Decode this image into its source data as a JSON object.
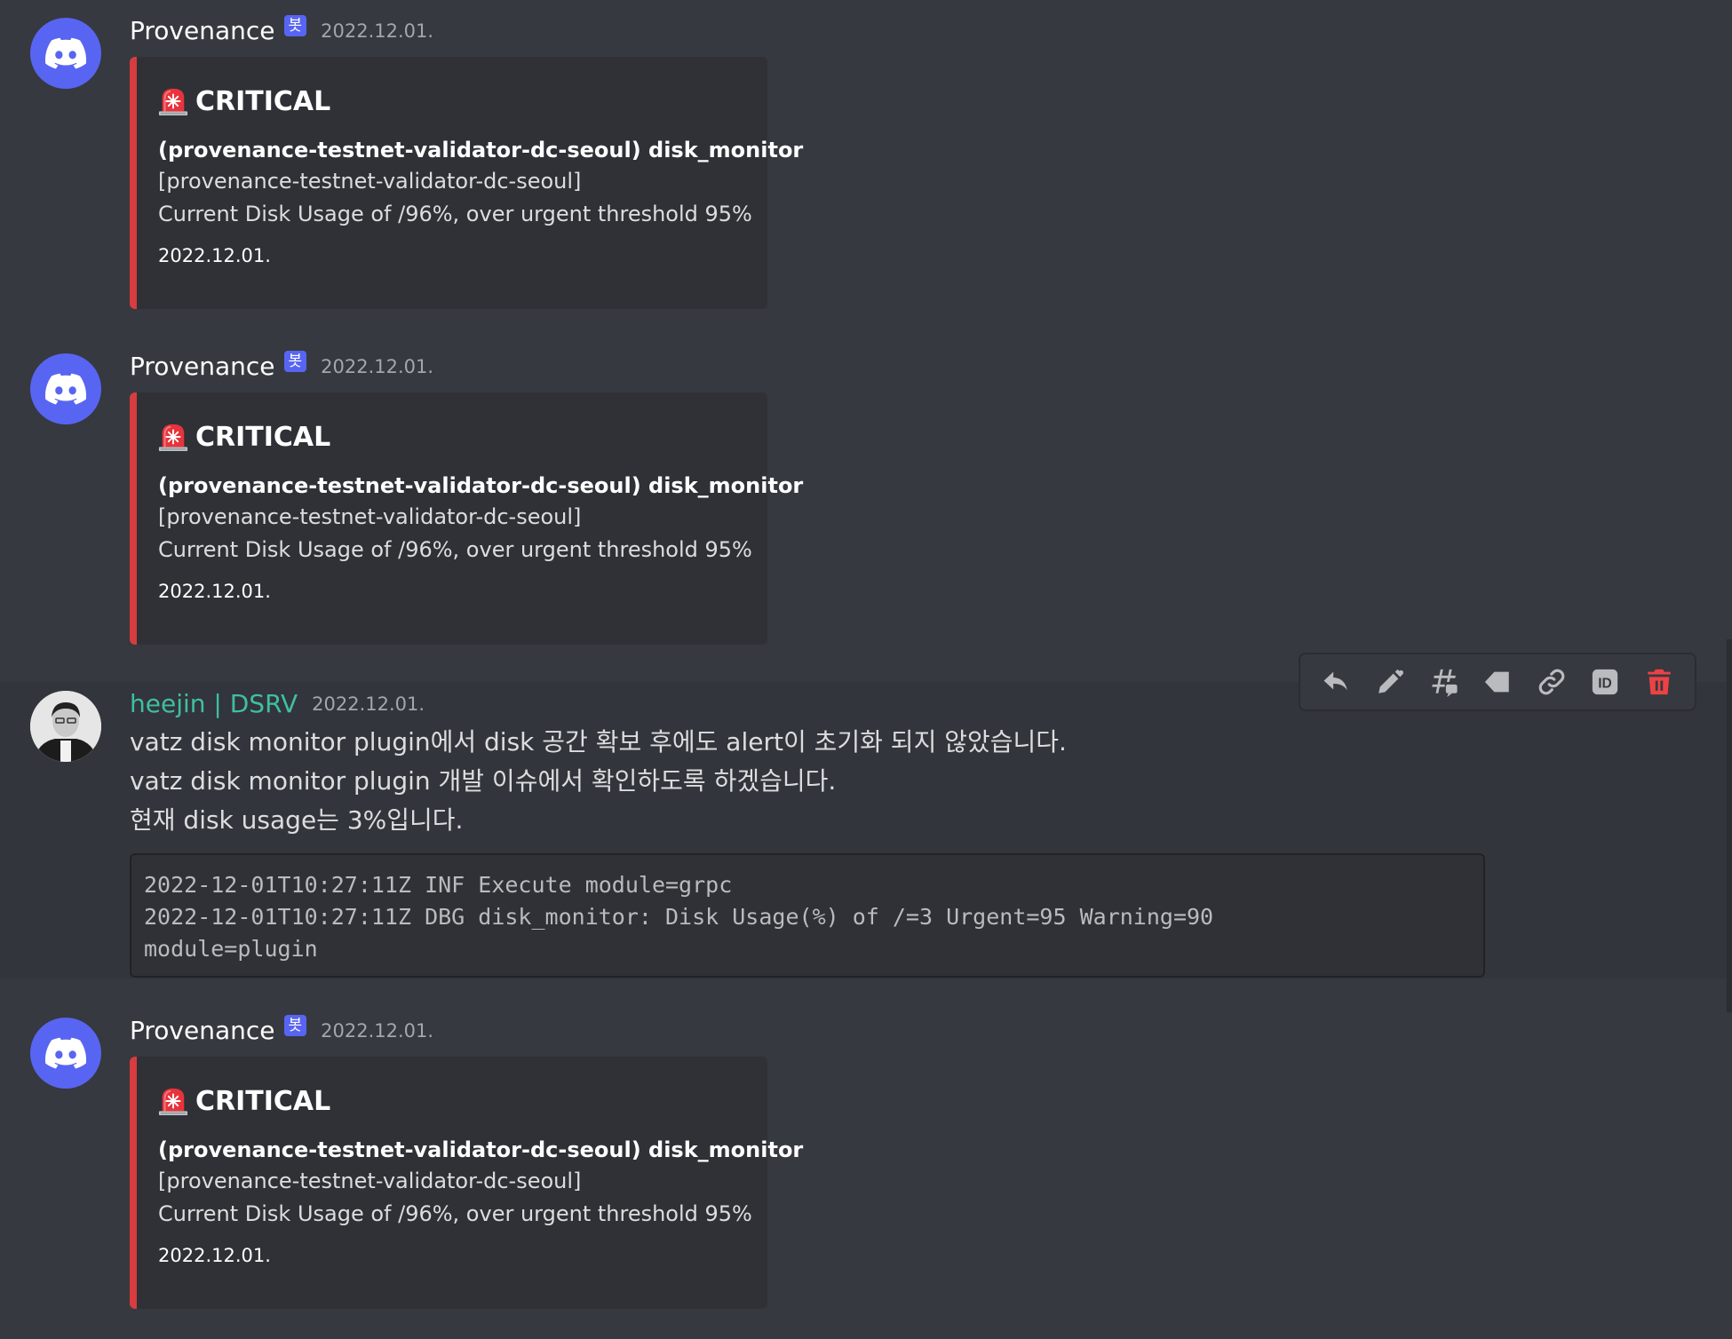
{
  "colors": {
    "background": "#36393f",
    "embed_background": "#2f3136",
    "embed_accent_critical": "#d83c3e",
    "blurple": "#5865f2",
    "username_user": "#3fbfa0",
    "delete_red": "#ed4245"
  },
  "messages": [
    {
      "author": "Provenance",
      "bot_tag": "봇",
      "avatar_icon": "discord-logo-icon",
      "timestamp": "2022.12.01.",
      "embed": {
        "icon": "rotating-light-icon",
        "title": "CRITICAL",
        "description_bold": "(provenance-testnet-validator-dc-seoul) disk_monitor",
        "description_lines": [
          "[provenance-testnet-validator-dc-seoul]",
          "Current Disk Usage of /96%, over urgent threshold 95%"
        ],
        "footer": "2022.12.01."
      }
    },
    {
      "author": "Provenance",
      "bot_tag": "봇",
      "avatar_icon": "discord-logo-icon",
      "timestamp": "2022.12.01.",
      "embed": {
        "icon": "rotating-light-icon",
        "title": "CRITICAL",
        "description_bold": "(provenance-testnet-validator-dc-seoul) disk_monitor",
        "description_lines": [
          "[provenance-testnet-validator-dc-seoul]",
          "Current Disk Usage of /96%, over urgent threshold 95%"
        ],
        "footer": "2022.12.01."
      }
    },
    {
      "author": "heejin | DSRV",
      "timestamp": "2022.12.01.",
      "text_lines": [
        "vatz disk monitor plugin에서 disk 공간 확보 후에도 alert이 초기화 되지 않았습니다.",
        "vatz disk monitor plugin 개발 이슈에서 확인하도록 하겠습니다.",
        "현재 disk usage는 3%입니다."
      ],
      "code_lines": [
        "2022-12-01T10:27:11Z INF Execute module=grpc",
        "2022-12-01T10:27:11Z DBG disk_monitor: Disk Usage(%) of /=3 Urgent=95 Warning=90",
        "module=plugin"
      ]
    },
    {
      "author": "Provenance",
      "bot_tag": "봇",
      "avatar_icon": "discord-logo-icon",
      "timestamp": "2022.12.01.",
      "embed": {
        "icon": "rotating-light-icon",
        "title": "CRITICAL",
        "description_bold": "(provenance-testnet-validator-dc-seoul) disk_monitor",
        "description_lines": [
          "[provenance-testnet-validator-dc-seoul]",
          "Current Disk Usage of /96%, over urgent threshold 95%"
        ],
        "footer": "2022.12.01."
      }
    }
  ],
  "toolbar": {
    "buttons": [
      "reply-icon",
      "edit-icon",
      "create-thread-icon",
      "tag-icon",
      "copy-link-icon",
      "copy-id-icon",
      "delete-icon"
    ],
    "id_label": "ID"
  }
}
